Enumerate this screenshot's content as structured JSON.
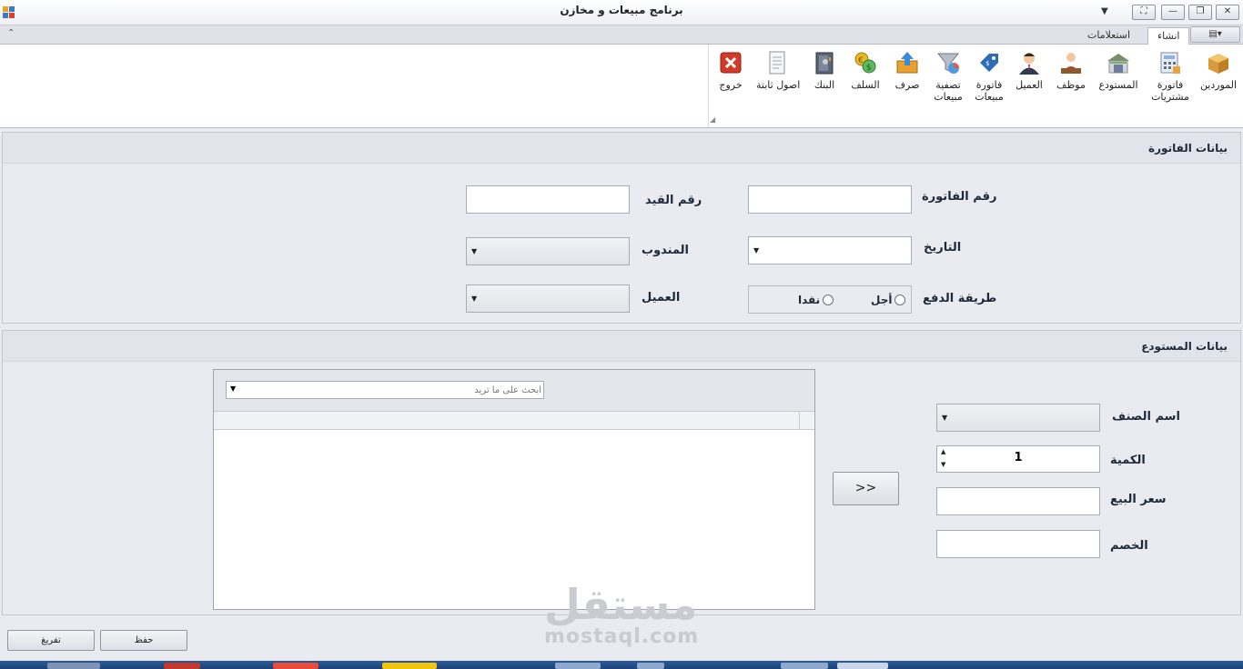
{
  "window": {
    "title": "برنامج مبيعات و مخازن",
    "qat_glyph": "▼",
    "buttons": {
      "fullscreen": "⛶",
      "minimize": "—",
      "restore": "❐",
      "close": "✕"
    }
  },
  "ribbon": {
    "collapse_glyph": "⌃",
    "app_menu_glyph": "▤▾",
    "tabs": [
      {
        "label": "انشاء",
        "active": true
      },
      {
        "label": "استعلامات",
        "active": false
      }
    ],
    "buttons": [
      {
        "label": "الموردين",
        "icon": "box-icon"
      },
      {
        "label": "فاتورة\nمشتريات",
        "icon": "calculator-icon"
      },
      {
        "label": "المستودع",
        "icon": "warehouse-icon"
      },
      {
        "label": "موظف",
        "icon": "employee-icon"
      },
      {
        "label": "العميل",
        "icon": "customer-icon"
      },
      {
        "label": "فاتورة\nمبيعات",
        "icon": "tag-icon"
      },
      {
        "label": "تصفية\nمبيعات",
        "icon": "filter-icon"
      },
      {
        "label": "صرف",
        "icon": "outbox-icon"
      },
      {
        "label": "السلف",
        "icon": "coins-icon"
      },
      {
        "label": "البنك",
        "icon": "safe-icon"
      },
      {
        "label": "اصول ثابتة",
        "icon": "document-icon"
      },
      {
        "label": "خروج",
        "icon": "exit-icon"
      }
    ]
  },
  "invoice": {
    "header": "بيانات الفاتورة",
    "invoice_number_label": "رقم الفاتورة",
    "invoice_number": "",
    "entry_number_label": "رقم القيد",
    "entry_number": "",
    "date_label": "التاريخ",
    "date": "",
    "rep_label": "المندوب",
    "rep": "",
    "payment_method_label": "طريقة الدفع",
    "payment_options": [
      "أجل",
      "نقدا"
    ],
    "customer_label": "العميل",
    "customer": ""
  },
  "warehouse": {
    "header": "بيانات المستودع",
    "item_name_label": "اسم الصنف",
    "item_name": "",
    "quantity_label": "الكمية",
    "quantity": "1",
    "sale_price_label": "سعر البيع",
    "sale_price": "",
    "discount_label": "الخصم",
    "discount": "",
    "add_button": ">>",
    "search_placeholder": "ابحث على ما تريد",
    "spin_up": "▲",
    "spin_down": "▼",
    "dropdown_glyph": "▼"
  },
  "footer": {
    "save_button": "حفظ",
    "clear_button": "تفريغ"
  },
  "watermark": {
    "arabic": "مستقل",
    "latin": "mostaql.com"
  }
}
